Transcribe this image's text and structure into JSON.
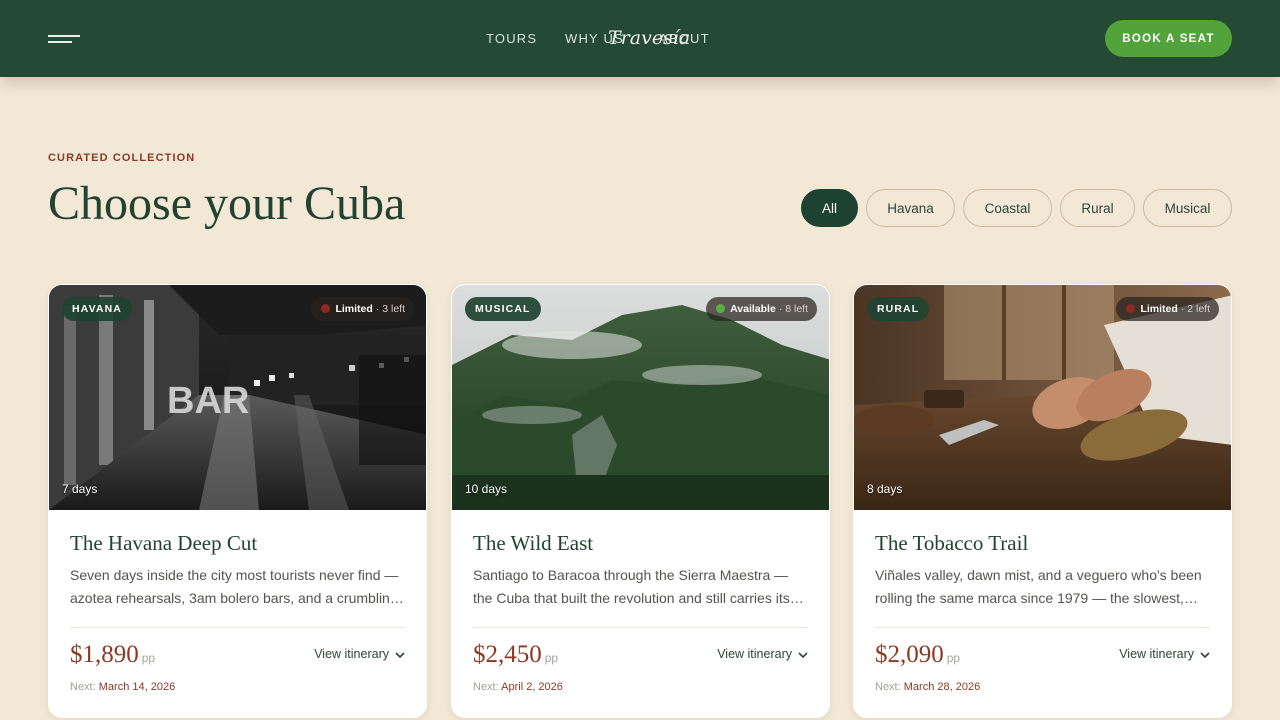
{
  "header": {
    "logo": "Travesía",
    "nav": [
      "TOURS",
      "WHY US",
      "ABOUT"
    ],
    "cta_label": "BOOK A SEAT"
  },
  "section": {
    "eyebrow": "CURATED COLLECTION",
    "title": "Choose your Cuba",
    "filters": [
      "All",
      "Havana",
      "Coastal",
      "Rural",
      "Musical"
    ],
    "active_filter": "All"
  },
  "tours": [
    {
      "tag": "HAVANA",
      "status": "Limited",
      "status_color": "#8b2a22",
      "seats_left": "· 3 left",
      "duration": "7 days",
      "title": "The Havana Deep Cut",
      "description": "Seven days inside the city most tourists never find — azotea rehearsals, 3am bolero bars, and a crumbling palace where the old men still gather to play.",
      "price": "$1,890",
      "price_unit": "pp",
      "itinerary_label": "View itinerary",
      "next_label": "Next:",
      "next_date": "March 14, 2026"
    },
    {
      "tag": "MUSICAL",
      "status": "Available",
      "status_color": "#5aae3f",
      "seats_left": "· 8 left",
      "duration": "10 days",
      "title": "The Wild East",
      "description": "Santiago to Baracoa through the Sierra Maestra — the Cuba that built the revolution and still carries its rhythm in every son band on the street.",
      "price": "$2,450",
      "price_unit": "pp",
      "itinerary_label": "View itinerary",
      "next_label": "Next:",
      "next_date": "April 2, 2026"
    },
    {
      "tag": "RURAL",
      "status": "Limited",
      "status_color": "#8b2a22",
      "seats_left": "· 2 left",
      "duration": "8 days",
      "title": "The Tobacco Trail",
      "description": "Viñales valley, dawn mist, and a veguero who's been rolling the same marca since 1979 — the slowest, most unhurried week you will spend.",
      "price": "$2,090",
      "price_unit": "pp",
      "itinerary_label": "View itinerary",
      "next_label": "Next:",
      "next_date": "March 28, 2026"
    }
  ],
  "colors": {
    "header_bg": "#244a36",
    "page_bg": "#f3e8d6",
    "cta": "#53a33b",
    "accent_rust": "#8a3a24",
    "heading_green": "#22432f"
  },
  "icons": [
    "menu-icon",
    "chevron-down-icon",
    "status-dot-icon"
  ]
}
